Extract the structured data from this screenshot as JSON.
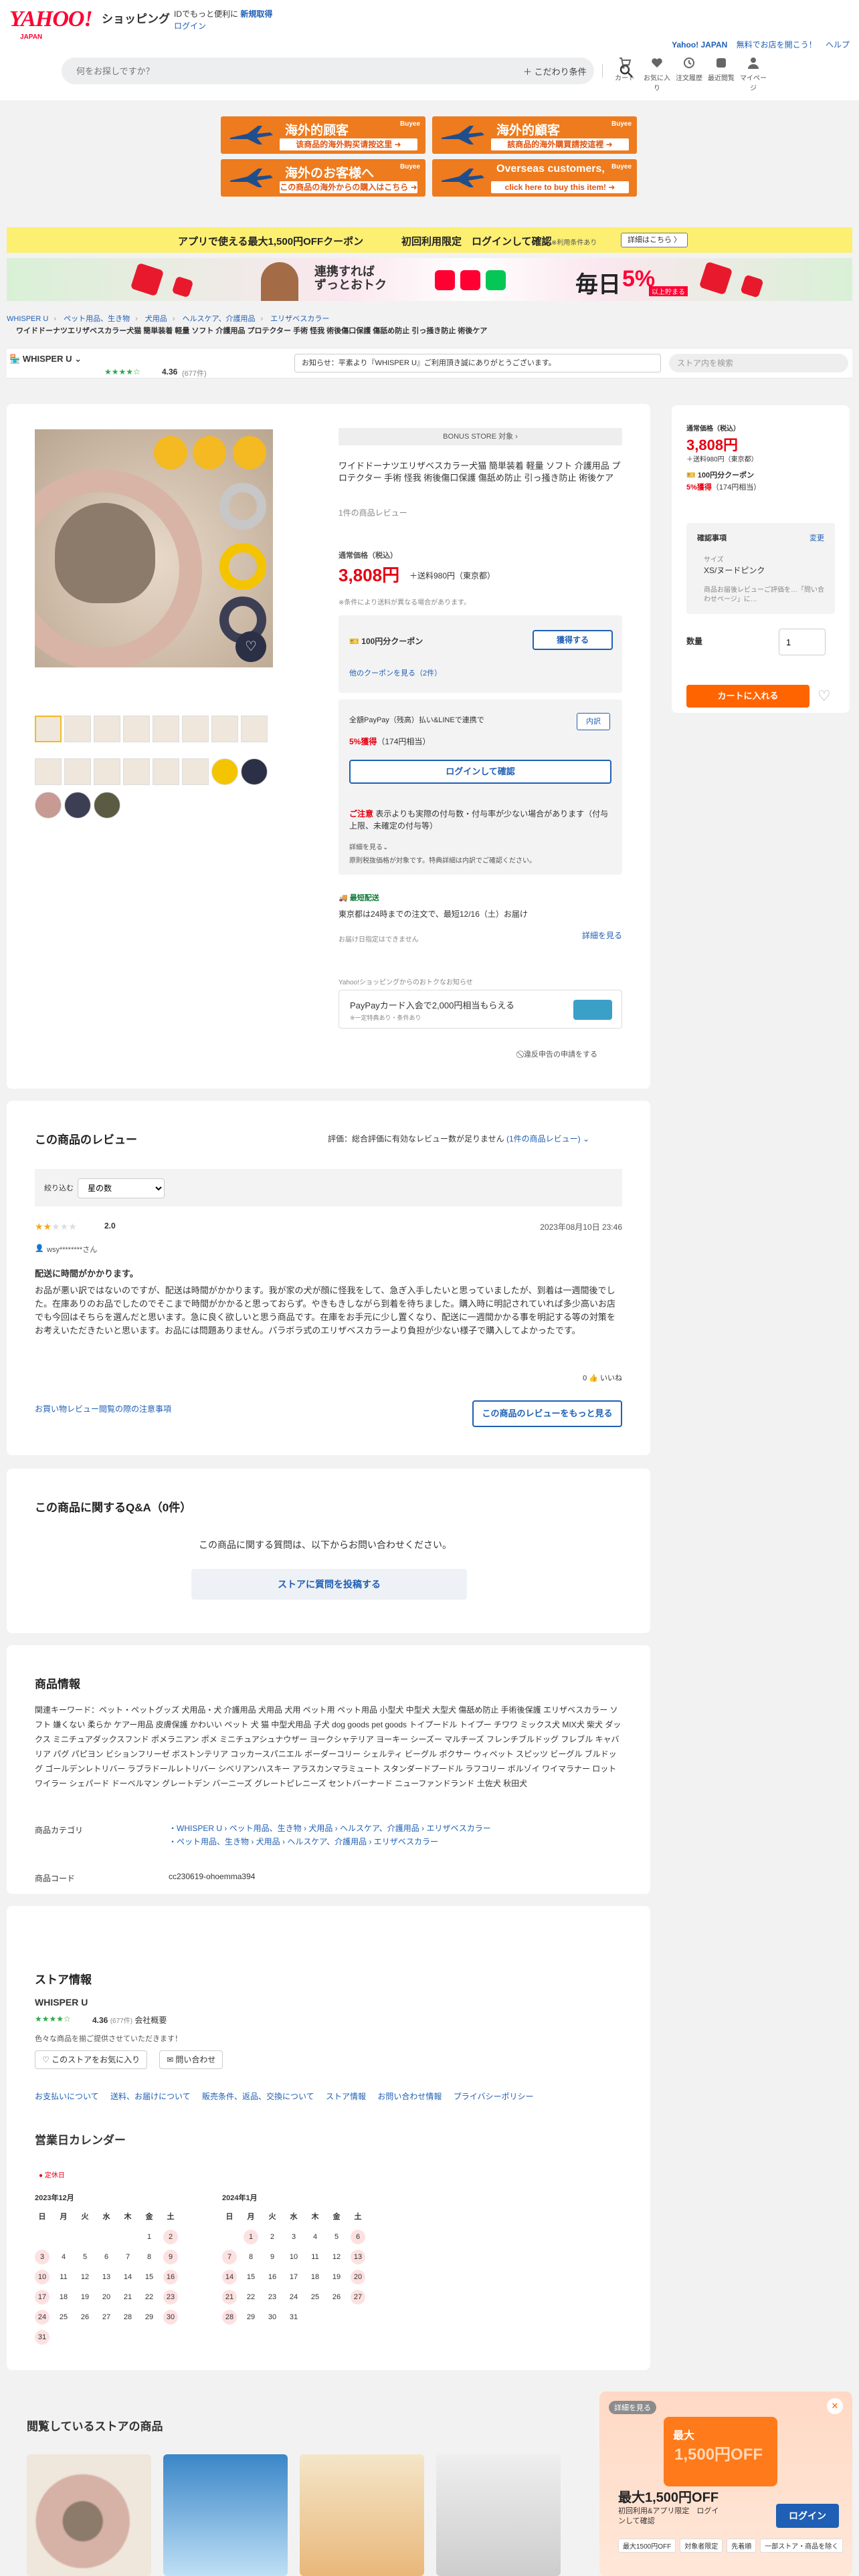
{
  "header": {
    "logo": "YAHOO!",
    "logo_sub": "JAPAN",
    "service": "ショッピング",
    "promo_prefix": "IDでもっと便利に",
    "promo_link": "新規取得",
    "login": "ログイン",
    "right_links": [
      "Yahoo! JAPAN",
      "無料でお店を開こう！",
      "ヘルプ"
    ],
    "search_placeholder": "何をお探しですか？",
    "kodawari": "＋ こだわり条件",
    "icons": [
      {
        "label": "カート",
        "icon": "cart-icon"
      },
      {
        "label": "お気に入り",
        "icon": "heart-icon"
      },
      {
        "label": "注文履歴",
        "icon": "history-icon"
      },
      {
        "label": "最近閲覧",
        "icon": "clock-icon"
      },
      {
        "label": "マイページ",
        "icon": "user-icon"
      }
    ]
  },
  "buyee": [
    {
      "t1": "海外的顾客",
      "t2": "该商品的海外购买请按这里 ➜",
      "brand": "Buyee"
    },
    {
      "t1": "海外的顧客",
      "t2": "該商品的海外購買請按這裡 ➜",
      "brand": "Buyee"
    },
    {
      "t1": "海外のお客様へ",
      "t2": "この商品の海外からの購入はこちら ➜",
      "brand": "Buyee"
    },
    {
      "t1": "Overseas customers,",
      "t2": "click here to buy this item! ➜",
      "brand": "Buyee"
    }
  ],
  "banner": {
    "text": "アプリで使える最大1,500円OFFクーポン",
    "text2": "初回利用限定　ログインして確認",
    "note": "※利用条件あり",
    "button": "詳細はこちら 〉"
  },
  "campaign": {
    "line1": "連携すれば",
    "line2": "ずっとおトク",
    "daily": "毎日",
    "percent": "5%",
    "small": "以上貯まる"
  },
  "breadcrumb": [
    "WHISPER U",
    "ペット用品、生き物",
    "犬用品",
    "ヘルスケア、介護用品",
    "エリザベスカラー"
  ],
  "product_title_short": "ワイドドーナツエリザベスカラー犬猫 簡単装着 軽量 ソフト 介護用品 プロテクター 手術 怪我 術後傷口保護 傷舐め防止 引っ掻き防止 術後ケア",
  "store": {
    "name": "WHISPER U",
    "rating": "4.36",
    "count": "(677件)",
    "notice": "お知らせ：平素より『WHISPER U』ご利用頂き誠にありがとうございます。",
    "search_placeholder": "ストア内を検索"
  },
  "product": {
    "bonus": "BONUS STORE 対象 ›",
    "title": "ワイドドーナツエリザベスカラー犬猫 簡単装着 軽量 ソフト 介護用品 プロテクター 手術 怪我 術後傷口保護 傷舐め防止 引っ掻き防止 術後ケア",
    "reviews": "1件の商品レビュー",
    "price_label": "通常価格（税込）",
    "price": "3,808円",
    "shipping": "＋送料980円（東京都）",
    "ship_note": "※条件により送料が異なる場合があります。",
    "coupon": "100円分クーポン",
    "coupon_btn": "獲得する",
    "coupon_link": "他のクーポンを見る（2件）",
    "paypay_line": "全額PayPay（残高）払い&LINEで連携で",
    "paypay_badge": "内訳",
    "points": "5%獲得",
    "points_note": "（174円相当）",
    "login_btn": "ログインして確認",
    "caution_head": "ご注意",
    "caution": "表示よりも実際の付与数・付与率が少ない場合があります（付与上限、未確定の付与等）",
    "detail": "詳細を見る⌄",
    "exclude": "原則税抜価格が対象です。特典詳細は内訳でご確認ください。",
    "delivery_badge": "最短配送",
    "delivery": "東京都は24時までの注文で、最短12/16（土）お届け",
    "delivery_note": "お届け日指定はできません",
    "delivery_link": "詳細を見る",
    "notice_head": "Yahoo!ショッピングからのおトクなお知らせ",
    "pp_title": "PayPayカード入会で2,000円相当もらえる",
    "pp_note": "※一定特典あり・条件あり",
    "report": "⃠ 違反申告の申請をする"
  },
  "side": {
    "price_label": "通常価格（税込）",
    "price": "3,808円",
    "shipping": "＋送料980円（東京都）",
    "coupon": "100円分クーポン",
    "points": "5%獲得",
    "points_note": "（174円相当）",
    "confirm": "確認事項",
    "change": "変更",
    "size_label": "サイズ",
    "size": "XS/ヌードピンク",
    "memo": "商品お届後レビューご評価を…「問い合わせページ」に…",
    "qty_label": "数量",
    "qty": "1",
    "cart": "カートに入れる"
  },
  "reviews": {
    "title": "この商品のレビュー",
    "eval": "評価：総合評価に有効なレビュー数が足りません",
    "eval_link": "(1件の商品レビュー) ⌄",
    "filter_label": "絞り込む",
    "filter_value": "星の数",
    "score": "2.0",
    "date": "2023年08月10日 23:46",
    "user": "wsy********さん",
    "heading": "配送に時間がかかります。",
    "body": "お品が悪い訳ではないのですが、配送は時間がかかります。我が家の犬が顔に怪我をして、急ぎ入手したいと思っていましたが、到着は一週間後でした。在庫ありのお品でしたのでそこまで時間がかかると思っておらず。やきもきしながら到着を待ちました。購入時に明記されていれば多少高いお店でも今回はそちらを選んだと思います。急に良く欲しいと思う商品です。在庫をお手元に少し置くなり、配送に一週間かかる事を明記する等の対策をお考えいただきたいと思います。お品には問題ありません。パラボラ式のエリザベスカラーより負担が少ない様子で購入してよかったです。",
    "likes": "0 👍 いいね",
    "note_link": "お買い物レビュー閲覧の際の注意事項",
    "more": "この商品のレビューをもっと見る"
  },
  "qa": {
    "title": "この商品に関するQ&A（0件）",
    "text": "この商品に関する質問は、以下からお問い合わせください。",
    "button": "ストアに質問を投稿する"
  },
  "info": {
    "title": "商品情報",
    "keywords": "関連キーワード：ペット・ペットグッズ 犬用品・犬 介護用品 犬用品 犬用 ペット用 ペット用品 小型犬 中型犬 大型犬 傷舐め防止 手術後保護 エリザベスカラー ソフト 嫌くない 柔らか ケアー用品 皮膚保護 かわいい ペット 犬 猫 中型犬用品 子犬 dog goods pet goods トイプードル トイプー チワワ ミックス犬 MIX犬 柴犬 ダックス ミニチュアダックスフンド ポメラニアン ポメ ミニチュアシュナウザー ヨークシャテリア ヨーキー シーズー マルチーズ フレンチブルドッグ フレブル キャバリア パグ パピヨン ビションフリーゼ ボストンテリア コッカースパニエル ボーダーコリー シェルティ ビーグル ボクサー ウィペット スピッツ ビーグル ブルドッグ ゴールデンレトリバー ラブラドールレトリバー シベリアンハスキー アラスカンマラミュート スタンダードプードル ラフコリー ボルゾイ ワイマラナー ロットワイラー シェパード ドーベルマン グレートデン バーニーズ グレートピレニーズ セントバーナード ニューファンドランド 土佐犬 秋田犬",
    "category_label": "商品カテゴリ",
    "category1": "・WHISPER U › ペット用品、生き物 › 犬用品 › ヘルスケア、介護用品 › エリザベスカラー",
    "category2": "・ペット用品、生き物 › 犬用品 › ヘルスケア、介護用品 › エリザベスカラー",
    "code_label": "商品コード",
    "code": "cc230619-ohoemma394"
  },
  "store_info": {
    "title": "ストア情報",
    "name": "WHISPER U",
    "rating": "4.36",
    "count": "(677件)",
    "company": "会社概要",
    "note": "色々な商品を揃ご提供させていただきます！",
    "fav_btn": "♡ このストアをお気に入り",
    "contact_btn": "✉ 問い合わせ",
    "links": [
      "お支払いについて",
      "送料、お届けについて",
      "販売条件、返品、交換について",
      "ストア情報",
      "お問い合わせ情報",
      "プライバシーポリシー"
    ],
    "cal_title": "営業日カレンダー",
    "cal_legend": "● 定休日",
    "months": [
      {
        "label": "2023年12月",
        "lead": 5,
        "days": 31,
        "off": [
          2,
          3,
          9,
          10,
          16,
          17,
          23,
          24,
          30,
          31
        ]
      },
      {
        "label": "2024年1月",
        "lead": 1,
        "days": 31,
        "off": [
          1,
          6,
          7,
          13,
          14,
          20,
          21,
          27,
          28
        ]
      }
    ],
    "weekdays": [
      "日",
      "月",
      "火",
      "水",
      "木",
      "金",
      "土"
    ]
  },
  "browsed": {
    "title": "閲覧しているストアの商品"
  },
  "float": {
    "badge": "詳細を見る",
    "coupon_t1": "最大",
    "coupon_t2": "1,500円OFF",
    "title": "最大1,500円OFF",
    "text": "初回利用&アプリ限定　ログインして確認",
    "login": "ログイン",
    "tags": [
      "最大1500円OFF",
      "対象者限定",
      "先着順",
      "一部ストア・商品を除く"
    ]
  },
  "colors": {
    "brand_red": "#ff0033",
    "price_red": "#e60012",
    "link_blue": "#1f5fb5",
    "cart_orange": "#ff6400",
    "buyee_orange": "#ee7b1e"
  }
}
